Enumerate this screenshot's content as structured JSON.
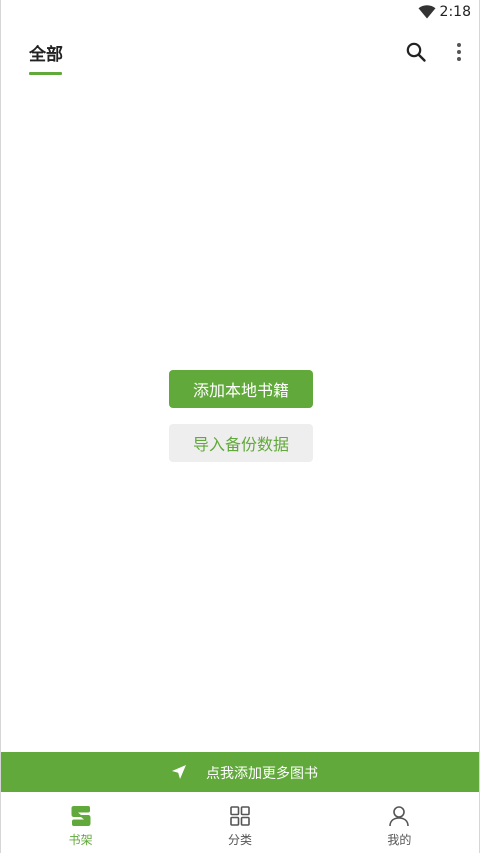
{
  "status_bar": {
    "time": "2:18",
    "wifi_icon": "wifi-icon"
  },
  "header": {
    "tab_label": "全部",
    "search_icon": "search-icon",
    "more_icon": "more-vertical-icon",
    "accent_color": "#61a93a"
  },
  "empty_state": {
    "add_local_label": "添加本地书籍",
    "import_backup_label": "导入备份数据"
  },
  "promo": {
    "icon": "navigation-arrow-icon",
    "text": "点我添加更多图书"
  },
  "bottom_nav": {
    "items": [
      {
        "label": "书架",
        "icon": "bookshelf-icon",
        "active": true
      },
      {
        "label": "分类",
        "icon": "category-grid-icon",
        "active": false
      },
      {
        "label": "我的",
        "icon": "person-icon",
        "active": false
      }
    ]
  }
}
